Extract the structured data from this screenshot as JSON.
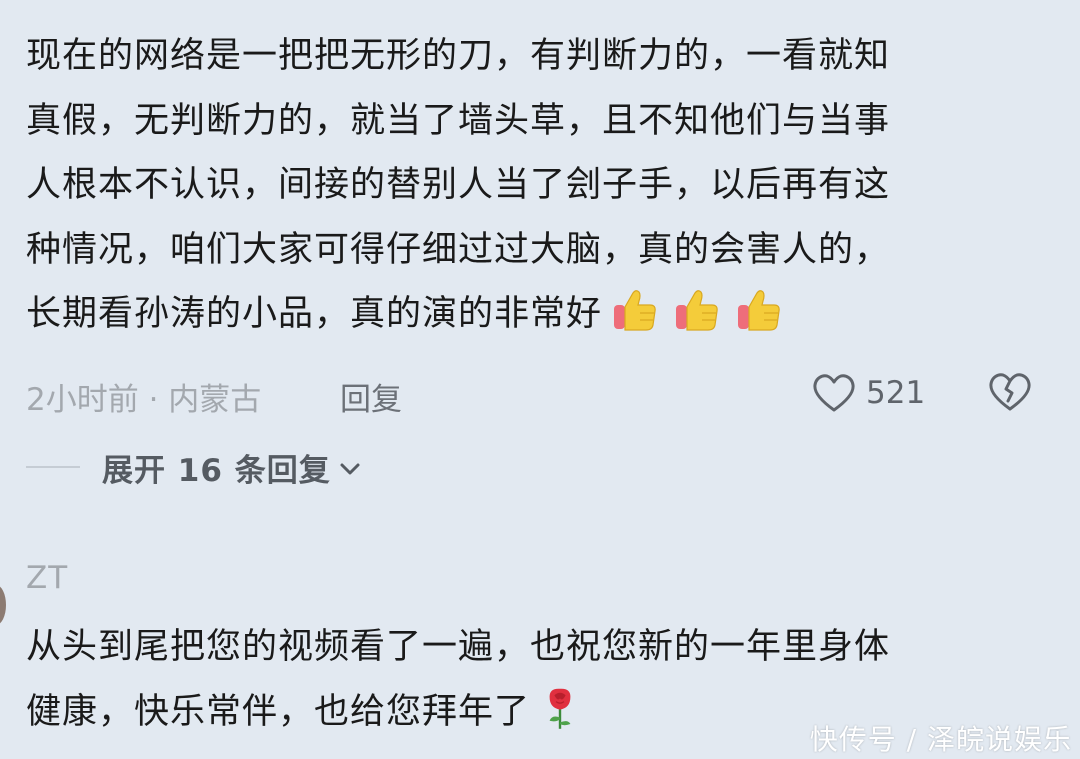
{
  "comment1": {
    "lines": [
      "现在的网络是一把把无形的刀，有判断力的，一看就知",
      "真假，无判断力的，就当了墙头草，且不知他们与当事",
      "人根本不认识，间接的替别人当了刽子手，以后再有这",
      "种情况，咱们大家可得仔细过过大脑，真的会害人的，",
      "长期看孙涛的小品，真的演的非常好"
    ],
    "emojis": [
      "thumbs-up",
      "thumbs-up",
      "thumbs-up"
    ],
    "time_location": "2小时前 · 内蒙古",
    "reply_label": "回复",
    "like_count": "521"
  },
  "expand": {
    "label": "展开 16 条回复"
  },
  "comment2": {
    "username": "ZT",
    "lines": [
      "从头到尾把您的视频看了一遍，也祝您新的一年里身体",
      "健康，快乐常伴，也给您拜年了"
    ],
    "emoji": "rose"
  },
  "watermark": "快传号 / 泽皖说娱乐",
  "colors": {
    "background": "#e2e9f1",
    "text": "#1a1a1a",
    "meta": "#a3a8ae",
    "thumb": "#f4cc3a",
    "cuff": "#ee6d7a",
    "rose": "#e0303f"
  }
}
